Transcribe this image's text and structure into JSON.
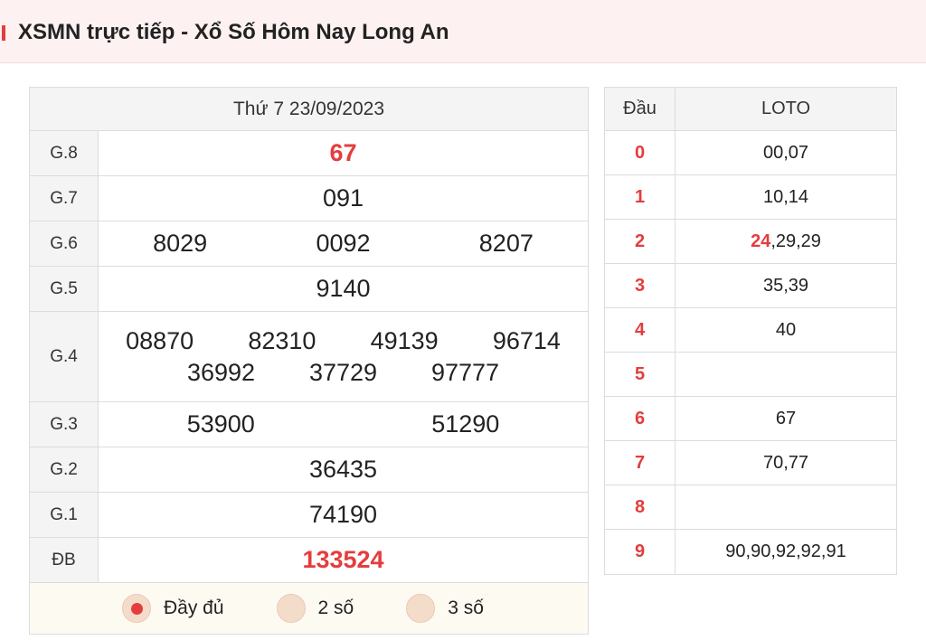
{
  "header": {
    "title": "XSMN trực tiếp - Xổ Số Hôm Nay Long An"
  },
  "result": {
    "date": "Thứ 7 23/09/2023",
    "prizes": [
      {
        "label": "G.8",
        "numbers": [
          "67"
        ]
      },
      {
        "label": "G.7",
        "numbers": [
          "091"
        ]
      },
      {
        "label": "G.6",
        "numbers": [
          "8029",
          "0092",
          "8207"
        ]
      },
      {
        "label": "G.5",
        "numbers": [
          "9140"
        ]
      },
      {
        "label": "G.4",
        "numbers": [
          "08870",
          "82310",
          "49139",
          "96714",
          "36992",
          "37729",
          "97777"
        ]
      },
      {
        "label": "G.3",
        "numbers": [
          "53900",
          "51290"
        ]
      },
      {
        "label": "G.2",
        "numbers": [
          "36435"
        ]
      },
      {
        "label": "G.1",
        "numbers": [
          "74190"
        ]
      },
      {
        "label": "ĐB",
        "numbers": [
          "133524"
        ]
      }
    ],
    "options": [
      "Đầy đủ",
      "2 số",
      "3 số"
    ],
    "selected_option": "Đầy đủ"
  },
  "loto": {
    "head_col": "Đầu",
    "loto_col": "LOTO",
    "rows": [
      {
        "head": "0",
        "highlight": "",
        "values": "00,07"
      },
      {
        "head": "1",
        "highlight": "",
        "values": "10,14"
      },
      {
        "head": "2",
        "highlight": "24",
        "values": ",29,29"
      },
      {
        "head": "3",
        "highlight": "",
        "values": "35,39"
      },
      {
        "head": "4",
        "highlight": "",
        "values": "40"
      },
      {
        "head": "5",
        "highlight": "",
        "values": ""
      },
      {
        "head": "6",
        "highlight": "",
        "values": "67"
      },
      {
        "head": "7",
        "highlight": "",
        "values": "70,77"
      },
      {
        "head": "8",
        "highlight": "",
        "values": ""
      },
      {
        "head": "9",
        "highlight": "",
        "values": "90,90,92,92,91"
      }
    ]
  },
  "colors": {
    "accent": "#e43d3d",
    "header_bg": "#fdf1f1",
    "cell_bg": "#f4f4f4"
  }
}
